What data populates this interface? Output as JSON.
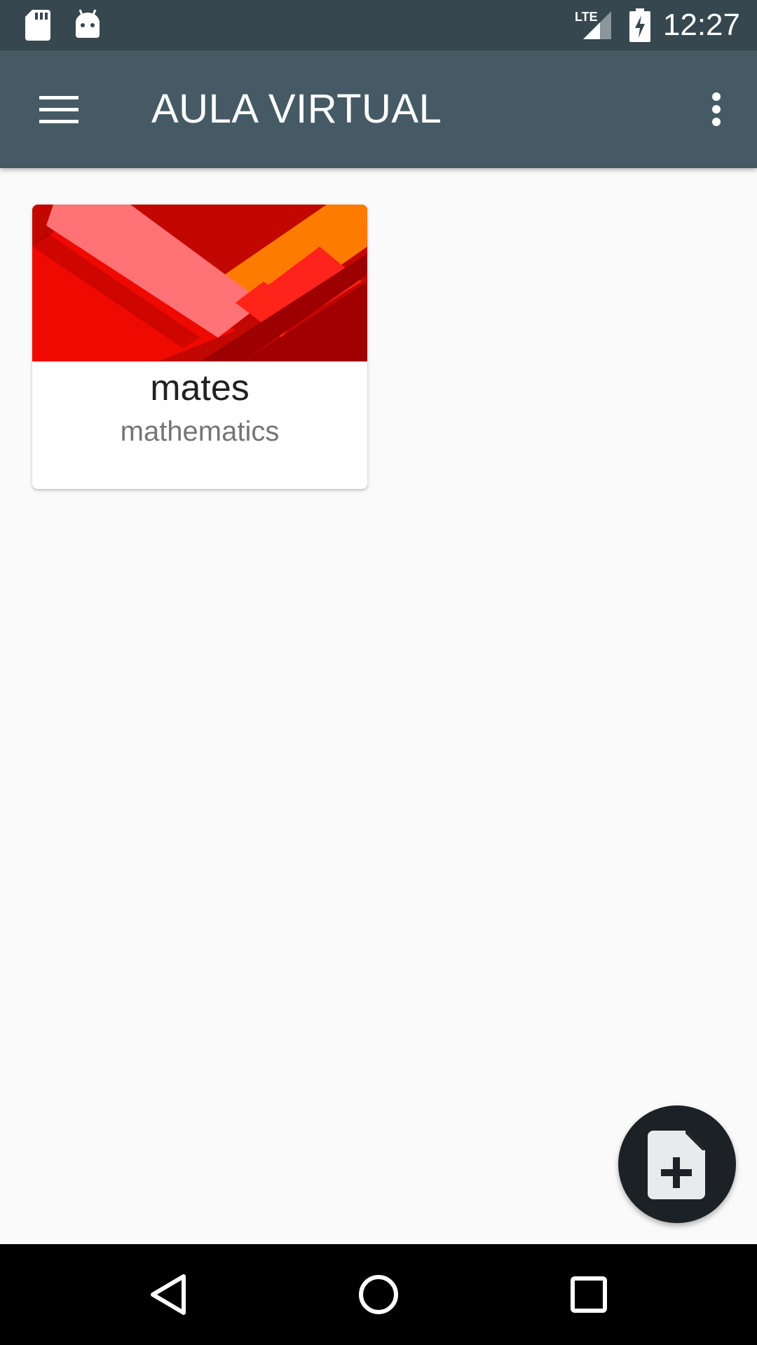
{
  "status_bar": {
    "time": "12:27",
    "network": "LTE",
    "icons": [
      "sd-card-icon",
      "android-debug-icon",
      "lte-signal-icon",
      "battery-charging-icon"
    ]
  },
  "app_bar": {
    "title": "AULA VIRTUAL",
    "background": "#455a64",
    "status_background": "#37474f",
    "left_icon": "menu-icon",
    "right_icon": "overflow-menu-icon"
  },
  "courses": [
    {
      "name": "mates",
      "subject": "mathematics"
    }
  ],
  "fab": {
    "icon": "new-document-icon",
    "background": "#1c2126"
  },
  "nav_bar": {
    "icons": [
      "back-icon",
      "home-icon",
      "recents-icon"
    ]
  }
}
